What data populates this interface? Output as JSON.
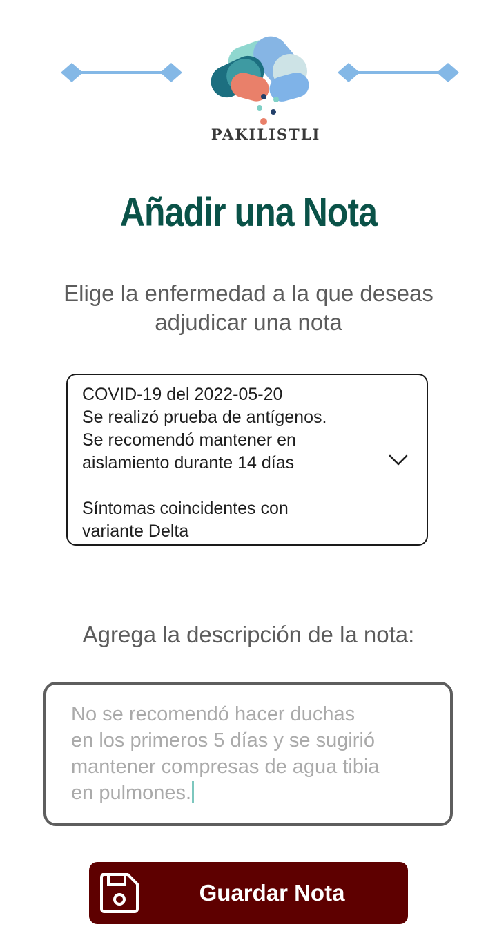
{
  "brand": {
    "name": "PAKILISTLI"
  },
  "page": {
    "title": "Añadir una Nota",
    "instruction": "Elige la enfermedad a la que deseas adjudicar una nota"
  },
  "disease_select": {
    "selected_lines": [
      "COVID-19 del 2022-05-20",
      "Se realizó prueba de antígenos.",
      "Se recomendó mantener en",
      "aislamiento durante 14 días",
      "",
      "Síntomas coincidentes con",
      "variante Delta"
    ],
    "icon": "chevron-down-icon"
  },
  "description": {
    "label": "Agrega la descripción de la nota:",
    "lines": [
      "No se recomendó hacer duchas",
      "en los primeros 5 días y se sugirió",
      "mantener compresas de agua tibia",
      "en pulmones."
    ]
  },
  "actions": {
    "save_label": "Guardar Nota",
    "save_icon": "floppy-disk-icon"
  },
  "colors": {
    "title": "#0a5248",
    "button": "#5e0000",
    "accent_blue": "#84b8e6",
    "caret": "#7dc7be"
  }
}
